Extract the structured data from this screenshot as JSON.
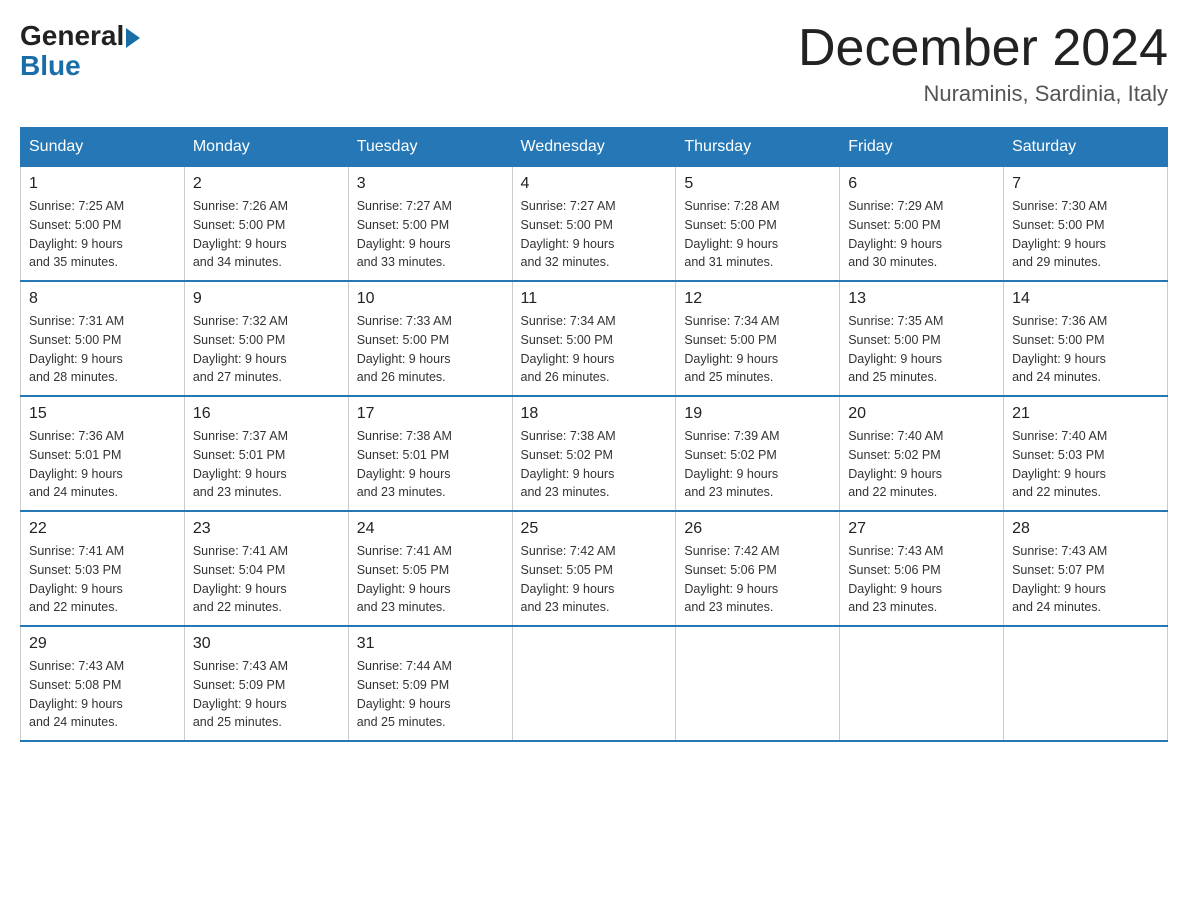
{
  "header": {
    "logo_general": "General",
    "logo_blue": "Blue",
    "month_year": "December 2024",
    "location": "Nuraminis, Sardinia, Italy"
  },
  "days_of_week": [
    "Sunday",
    "Monday",
    "Tuesday",
    "Wednesday",
    "Thursday",
    "Friday",
    "Saturday"
  ],
  "weeks": [
    [
      {
        "day": "1",
        "sunrise": "7:25 AM",
        "sunset": "5:00 PM",
        "daylight": "9 hours and 35 minutes."
      },
      {
        "day": "2",
        "sunrise": "7:26 AM",
        "sunset": "5:00 PM",
        "daylight": "9 hours and 34 minutes."
      },
      {
        "day": "3",
        "sunrise": "7:27 AM",
        "sunset": "5:00 PM",
        "daylight": "9 hours and 33 minutes."
      },
      {
        "day": "4",
        "sunrise": "7:27 AM",
        "sunset": "5:00 PM",
        "daylight": "9 hours and 32 minutes."
      },
      {
        "day": "5",
        "sunrise": "7:28 AM",
        "sunset": "5:00 PM",
        "daylight": "9 hours and 31 minutes."
      },
      {
        "day": "6",
        "sunrise": "7:29 AM",
        "sunset": "5:00 PM",
        "daylight": "9 hours and 30 minutes."
      },
      {
        "day": "7",
        "sunrise": "7:30 AM",
        "sunset": "5:00 PM",
        "daylight": "9 hours and 29 minutes."
      }
    ],
    [
      {
        "day": "8",
        "sunrise": "7:31 AM",
        "sunset": "5:00 PM",
        "daylight": "9 hours and 28 minutes."
      },
      {
        "day": "9",
        "sunrise": "7:32 AM",
        "sunset": "5:00 PM",
        "daylight": "9 hours and 27 minutes."
      },
      {
        "day": "10",
        "sunrise": "7:33 AM",
        "sunset": "5:00 PM",
        "daylight": "9 hours and 26 minutes."
      },
      {
        "day": "11",
        "sunrise": "7:34 AM",
        "sunset": "5:00 PM",
        "daylight": "9 hours and 26 minutes."
      },
      {
        "day": "12",
        "sunrise": "7:34 AM",
        "sunset": "5:00 PM",
        "daylight": "9 hours and 25 minutes."
      },
      {
        "day": "13",
        "sunrise": "7:35 AM",
        "sunset": "5:00 PM",
        "daylight": "9 hours and 25 minutes."
      },
      {
        "day": "14",
        "sunrise": "7:36 AM",
        "sunset": "5:00 PM",
        "daylight": "9 hours and 24 minutes."
      }
    ],
    [
      {
        "day": "15",
        "sunrise": "7:36 AM",
        "sunset": "5:01 PM",
        "daylight": "9 hours and 24 minutes."
      },
      {
        "day": "16",
        "sunrise": "7:37 AM",
        "sunset": "5:01 PM",
        "daylight": "9 hours and 23 minutes."
      },
      {
        "day": "17",
        "sunrise": "7:38 AM",
        "sunset": "5:01 PM",
        "daylight": "9 hours and 23 minutes."
      },
      {
        "day": "18",
        "sunrise": "7:38 AM",
        "sunset": "5:02 PM",
        "daylight": "9 hours and 23 minutes."
      },
      {
        "day": "19",
        "sunrise": "7:39 AM",
        "sunset": "5:02 PM",
        "daylight": "9 hours and 23 minutes."
      },
      {
        "day": "20",
        "sunrise": "7:40 AM",
        "sunset": "5:02 PM",
        "daylight": "9 hours and 22 minutes."
      },
      {
        "day": "21",
        "sunrise": "7:40 AM",
        "sunset": "5:03 PM",
        "daylight": "9 hours and 22 minutes."
      }
    ],
    [
      {
        "day": "22",
        "sunrise": "7:41 AM",
        "sunset": "5:03 PM",
        "daylight": "9 hours and 22 minutes."
      },
      {
        "day": "23",
        "sunrise": "7:41 AM",
        "sunset": "5:04 PM",
        "daylight": "9 hours and 22 minutes."
      },
      {
        "day": "24",
        "sunrise": "7:41 AM",
        "sunset": "5:05 PM",
        "daylight": "9 hours and 23 minutes."
      },
      {
        "day": "25",
        "sunrise": "7:42 AM",
        "sunset": "5:05 PM",
        "daylight": "9 hours and 23 minutes."
      },
      {
        "day": "26",
        "sunrise": "7:42 AM",
        "sunset": "5:06 PM",
        "daylight": "9 hours and 23 minutes."
      },
      {
        "day": "27",
        "sunrise": "7:43 AM",
        "sunset": "5:06 PM",
        "daylight": "9 hours and 23 minutes."
      },
      {
        "day": "28",
        "sunrise": "7:43 AM",
        "sunset": "5:07 PM",
        "daylight": "9 hours and 24 minutes."
      }
    ],
    [
      {
        "day": "29",
        "sunrise": "7:43 AM",
        "sunset": "5:08 PM",
        "daylight": "9 hours and 24 minutes."
      },
      {
        "day": "30",
        "sunrise": "7:43 AM",
        "sunset": "5:09 PM",
        "daylight": "9 hours and 25 minutes."
      },
      {
        "day": "31",
        "sunrise": "7:44 AM",
        "sunset": "5:09 PM",
        "daylight": "9 hours and 25 minutes."
      },
      null,
      null,
      null,
      null
    ]
  ],
  "labels": {
    "sunrise": "Sunrise:",
    "sunset": "Sunset:",
    "daylight": "Daylight:"
  }
}
